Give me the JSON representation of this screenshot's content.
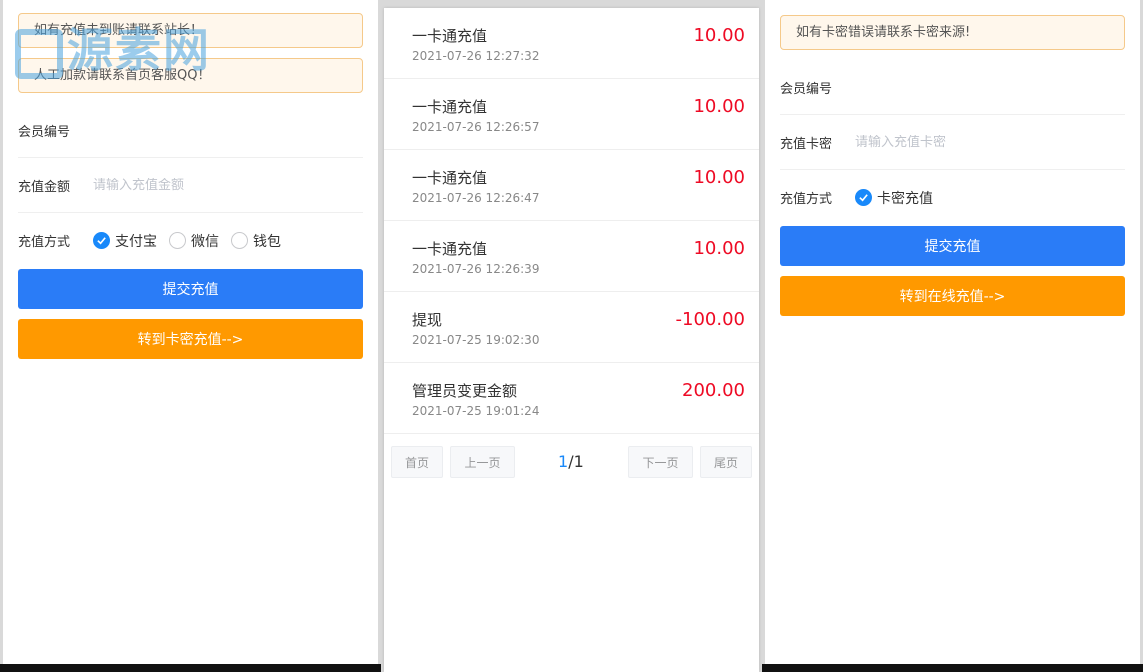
{
  "left_panel": {
    "notices": [
      "如有充值未到账请联系站长！",
      "人工加款请联系首页客服QQ！"
    ],
    "member_label": "会员编号",
    "amount_label": "充值金额",
    "amount_placeholder": "请输入充值金额",
    "method_label": "充值方式",
    "methods": [
      {
        "label": "支付宝",
        "checked": true
      },
      {
        "label": "微信",
        "checked": false
      },
      {
        "label": "钱包",
        "checked": false
      }
    ],
    "submit_label": "提交充值",
    "switch_label": "转到卡密充值-->"
  },
  "watermark": "源素网",
  "records": [
    {
      "title": "一卡通充值",
      "time": "2021-07-26 12:27:32",
      "amount": "10.00"
    },
    {
      "title": "一卡通充值",
      "time": "2021-07-26 12:26:57",
      "amount": "10.00"
    },
    {
      "title": "一卡通充值",
      "time": "2021-07-26 12:26:47",
      "amount": "10.00"
    },
    {
      "title": "一卡通充值",
      "time": "2021-07-26 12:26:39",
      "amount": "10.00"
    },
    {
      "title": "提现",
      "time": "2021-07-25 19:02:30",
      "amount": "-100.00"
    },
    {
      "title": "管理员变更金额",
      "time": "2021-07-25 19:01:24",
      "amount": "200.00"
    }
  ],
  "pager": {
    "first": "首页",
    "prev": "上一页",
    "current": "1",
    "separator": "/",
    "total": "1",
    "next": "下一页",
    "last": "尾页"
  },
  "right_panel": {
    "notice": "如有卡密错误请联系卡密来源!",
    "member_label": "会员编号",
    "card_label": "充值卡密",
    "card_placeholder": "请输入充值卡密",
    "method_label": "充值方式",
    "method_option": "卡密充值",
    "submit_label": "提交充值",
    "switch_label": "转到在线充值-->"
  },
  "colors": {
    "primary": "#2a7cf7",
    "warning": "#ff9900",
    "amount": "#ee0a24",
    "checked": "#1989fa"
  }
}
